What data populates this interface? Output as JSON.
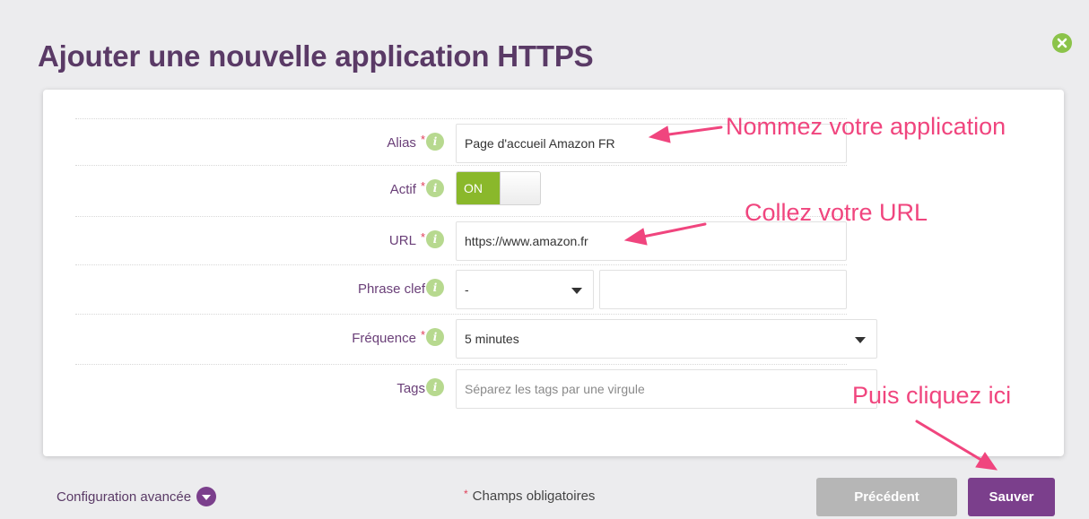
{
  "modal": {
    "title": "Ajouter une nouvelle application HTTPS"
  },
  "form": {
    "required_marker": "*",
    "alias": {
      "label": "Alias",
      "value": "Page d'accueil Amazon FR",
      "required": true
    },
    "actif": {
      "label": "Actif",
      "toggle_label": "ON",
      "state": "on",
      "required": true
    },
    "url": {
      "label": "URL",
      "value": "https://www.amazon.fr",
      "required": true
    },
    "keyword": {
      "label": "Phrase clef",
      "select_value": "-",
      "text_value": "",
      "required": false
    },
    "frequency": {
      "label": "Fréquence",
      "value": "5 minutes",
      "required": true
    },
    "tags": {
      "label": "Tags",
      "placeholder": "Séparez les tags par une virgule",
      "required": false
    }
  },
  "annotations": {
    "name_app": "Nommez votre application",
    "paste_url": "Collez votre URL",
    "click_here": "Puis cliquez ici"
  },
  "footer": {
    "advanced_config": "Configuration avancée",
    "required_fields_star": "*",
    "required_fields": "Champs obligatoires",
    "prev_button": "Précédent",
    "save_button": "Sauver"
  },
  "colors": {
    "title": "#5a3a66",
    "label": "#6a3f78",
    "required_star": "#e0405a",
    "info_icon": "#b7d98f",
    "toggle_on": "#8ab82b",
    "close_icon": "#8bc34a",
    "annotation": "#f0457e",
    "save_button": "#7b3f8c",
    "prev_button": "#b6b6b6"
  },
  "icons": {
    "close": "close-circle-icon",
    "info": "info-icon",
    "caret": "caret-down-icon",
    "advanced": "chevron-down-circle-icon"
  }
}
